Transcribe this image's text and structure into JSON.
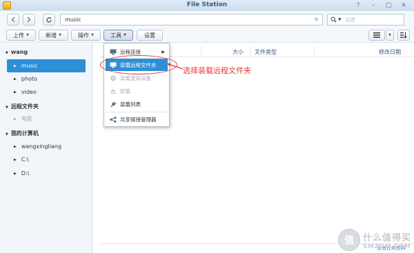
{
  "window": {
    "title": "File Station",
    "controls": [
      "?",
      "–",
      "□",
      "✕"
    ]
  },
  "toolbar": {
    "path": "music",
    "search_placeholder": "过滤",
    "buttons": {
      "upload": "上传",
      "create": "新增",
      "action": "操作",
      "tools": "工具",
      "settings": "设置"
    }
  },
  "sidebar": {
    "groups": [
      {
        "label": "wang",
        "items": [
          "music",
          "photo",
          "video"
        ]
      },
      {
        "label": "远程文件夹",
        "items": [
          "电影"
        ]
      },
      {
        "label": "我的计算机",
        "items": [
          "wangxingliang",
          "C:\\",
          "D:\\"
        ]
      }
    ],
    "selected": "music"
  },
  "columns": {
    "size": "大小",
    "type": "文件类型",
    "modified": "修改日期"
  },
  "tools_menu": {
    "items": [
      {
        "label": "远程连接",
        "icon": "monitor-icon",
        "has_submenu": true,
        "state": "normal"
      },
      {
        "label": "装载远程文件夹",
        "icon": "mount-icon",
        "state": "highlighted"
      },
      {
        "label": "装载虚拟设备",
        "icon": "disc-icon",
        "state": "disabled"
      },
      {
        "label": "卸载",
        "icon": "eject-icon",
        "state": "disabled"
      },
      {
        "label": "装载列表",
        "icon": "plug-icon",
        "state": "normal"
      },
      {
        "label": "共享链接管理器",
        "icon": "share-link-icon",
        "state": "normal"
      }
    ]
  },
  "annotation": {
    "text": "选择装载远程文件夹",
    "color": "#e53935"
  },
  "status": "没有任何资料",
  "watermark": {
    "symbol": "值",
    "text_cn": "什么值得买",
    "text_en": "SMZDM.COM"
  },
  "colors": {
    "accent": "#2e8fd6",
    "title": "#3a5a86",
    "annotation": "#e53935"
  }
}
